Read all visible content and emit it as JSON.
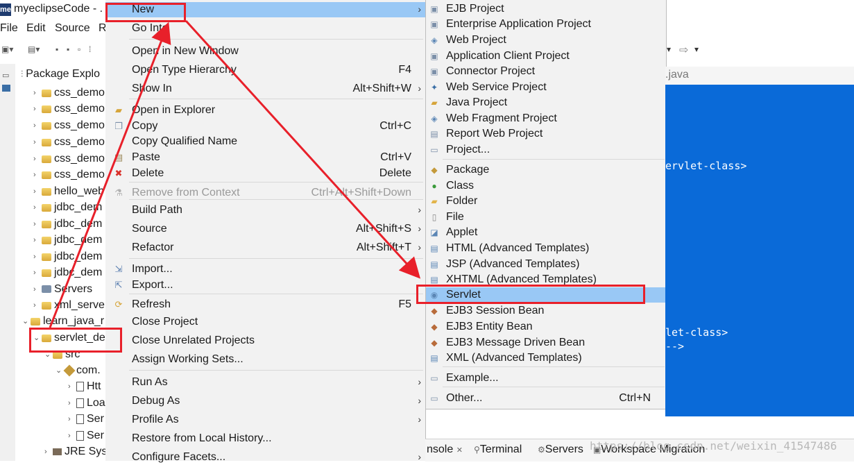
{
  "window": {
    "logo": "me",
    "title": "myeclipseCode - ."
  },
  "menubar": {
    "file": "File",
    "edit": "Edit",
    "source": "Source",
    "refactor": "R"
  },
  "package_explorer": {
    "title": "Package Explo",
    "items": [
      {
        "label": "css_demo",
        "type": "project",
        "expanded": false
      },
      {
        "label": "css_demo",
        "type": "project",
        "expanded": false
      },
      {
        "label": "css_demo",
        "type": "project",
        "expanded": false
      },
      {
        "label": "css_demo",
        "type": "project",
        "expanded": false
      },
      {
        "label": "css_demo",
        "type": "project",
        "expanded": false
      },
      {
        "label": "css_demo",
        "type": "project",
        "expanded": false
      },
      {
        "label": "hello_web",
        "type": "project",
        "expanded": false
      },
      {
        "label": "jdbc_dem",
        "type": "project",
        "expanded": false
      },
      {
        "label": "jdbc_dem",
        "type": "project",
        "expanded": false
      },
      {
        "label": "jdbc_dem",
        "type": "project",
        "expanded": false
      },
      {
        "label": "jdbc_dem",
        "type": "project",
        "expanded": false
      },
      {
        "label": "jdbc_dem",
        "type": "project",
        "expanded": false
      },
      {
        "label": "Servers",
        "type": "servers",
        "expanded": false
      },
      {
        "label": "xml_serve",
        "type": "project",
        "expanded": false
      },
      {
        "label": "learn_java_r",
        "type": "project",
        "expanded": true
      },
      {
        "label": "servlet_de",
        "type": "project",
        "expanded": true
      },
      {
        "label": "src",
        "type": "folder",
        "expanded": true
      },
      {
        "label": "com.",
        "type": "package",
        "expanded": true
      },
      {
        "label": "Htt",
        "type": "java",
        "expanded": false
      },
      {
        "label": "Loa",
        "type": "java",
        "expanded": false
      },
      {
        "label": "Ser",
        "type": "java",
        "expanded": false
      },
      {
        "label": "Ser",
        "type": "java",
        "expanded": false
      },
      {
        "label": "JRE Sys",
        "type": "library",
        "expanded": false
      }
    ]
  },
  "context_menu": {
    "items": [
      {
        "label": "New",
        "shortcut": "",
        "submenu": true,
        "icon": "",
        "selected": true
      },
      {
        "label": "Go Into",
        "shortcut": "",
        "submenu": false,
        "icon": ""
      },
      {
        "label": "Open in New Window",
        "shortcut": "",
        "submenu": false,
        "icon": ""
      },
      {
        "label": "Open Type Hierarchy",
        "shortcut": "F4",
        "submenu": false,
        "icon": ""
      },
      {
        "label": "Show In",
        "shortcut": "Alt+Shift+W",
        "submenu": true,
        "icon": ""
      },
      {
        "label": "Open in Explorer",
        "shortcut": "",
        "submenu": false,
        "icon": "explorer-icon"
      },
      {
        "label": "Copy",
        "shortcut": "Ctrl+C",
        "submenu": false,
        "icon": "copy-icon"
      },
      {
        "label": "Copy Qualified Name",
        "shortcut": "",
        "submenu": false,
        "icon": ""
      },
      {
        "label": "Paste",
        "shortcut": "Ctrl+V",
        "submenu": false,
        "icon": "paste-icon"
      },
      {
        "label": "Delete",
        "shortcut": "Delete",
        "submenu": false,
        "icon": "delete-icon"
      },
      {
        "label": "Remove from Context",
        "shortcut": "Ctrl+Alt+Shift+Down",
        "submenu": false,
        "icon": "remove-context-icon",
        "disabled": true
      },
      {
        "label": "Build Path",
        "shortcut": "",
        "submenu": true,
        "icon": ""
      },
      {
        "label": "Source",
        "shortcut": "Alt+Shift+S",
        "submenu": true,
        "icon": ""
      },
      {
        "label": "Refactor",
        "shortcut": "Alt+Shift+T",
        "submenu": true,
        "icon": ""
      },
      {
        "label": "Import...",
        "shortcut": "",
        "submenu": false,
        "icon": "import-icon"
      },
      {
        "label": "Export...",
        "shortcut": "",
        "submenu": false,
        "icon": "export-icon"
      },
      {
        "label": "Refresh",
        "shortcut": "F5",
        "submenu": false,
        "icon": "refresh-icon"
      },
      {
        "label": "Close Project",
        "shortcut": "",
        "submenu": false,
        "icon": ""
      },
      {
        "label": "Close Unrelated Projects",
        "shortcut": "",
        "submenu": false,
        "icon": ""
      },
      {
        "label": "Assign Working Sets...",
        "shortcut": "",
        "submenu": false,
        "icon": ""
      },
      {
        "label": "Run As",
        "shortcut": "",
        "submenu": true,
        "icon": ""
      },
      {
        "label": "Debug As",
        "shortcut": "",
        "submenu": true,
        "icon": ""
      },
      {
        "label": "Profile As",
        "shortcut": "",
        "submenu": true,
        "icon": ""
      },
      {
        "label": "Restore from Local History...",
        "shortcut": "",
        "submenu": false,
        "icon": ""
      },
      {
        "label": "Configure Facets...",
        "shortcut": "",
        "submenu": true,
        "icon": ""
      }
    ]
  },
  "new_submenu": {
    "items": [
      {
        "label": "EJB Project",
        "shortcut": ""
      },
      {
        "label": "Enterprise Application Project",
        "shortcut": ""
      },
      {
        "label": "Web Project",
        "shortcut": ""
      },
      {
        "label": "Application Client Project",
        "shortcut": ""
      },
      {
        "label": "Connector Project",
        "shortcut": ""
      },
      {
        "label": "Web Service Project",
        "shortcut": ""
      },
      {
        "label": "Java Project",
        "shortcut": ""
      },
      {
        "label": "Web Fragment Project",
        "shortcut": ""
      },
      {
        "label": "Report Web Project",
        "shortcut": ""
      },
      {
        "label": "Project...",
        "shortcut": ""
      },
      {
        "label": "Package",
        "shortcut": ""
      },
      {
        "label": "Class",
        "shortcut": ""
      },
      {
        "label": "Folder",
        "shortcut": ""
      },
      {
        "label": "File",
        "shortcut": ""
      },
      {
        "label": "Applet",
        "shortcut": ""
      },
      {
        "label": "HTML (Advanced Templates)",
        "shortcut": ""
      },
      {
        "label": "JSP (Advanced Templates)",
        "shortcut": ""
      },
      {
        "label": "XHTML (Advanced Templates)",
        "shortcut": ""
      },
      {
        "label": "Servlet",
        "shortcut": "",
        "selected": true
      },
      {
        "label": "EJB3 Session Bean",
        "shortcut": ""
      },
      {
        "label": "EJB3 Entity Bean",
        "shortcut": ""
      },
      {
        "label": "EJB3 Message Driven Bean",
        "shortcut": ""
      },
      {
        "label": "XML (Advanced Templates)",
        "shortcut": ""
      },
      {
        "label": "Example...",
        "shortcut": ""
      },
      {
        "label": "Other...",
        "shortcut": "Ctrl+N"
      }
    ]
  },
  "editor": {
    "tab_label": ".java",
    "lines": [
      "ervlet-class>",
      "let-class>",
      "-->"
    ]
  },
  "bottom_tabs": {
    "console": "nsole",
    "terminal": "Terminal",
    "servers": "Servers",
    "migration": "Workspace Migration"
  },
  "watermark": "https://blog.csdn.net/weixin_41547486",
  "colors": {
    "selection": "#99c8f5",
    "editor_bg": "#0a6ad8",
    "annotation": "#e8202a"
  }
}
